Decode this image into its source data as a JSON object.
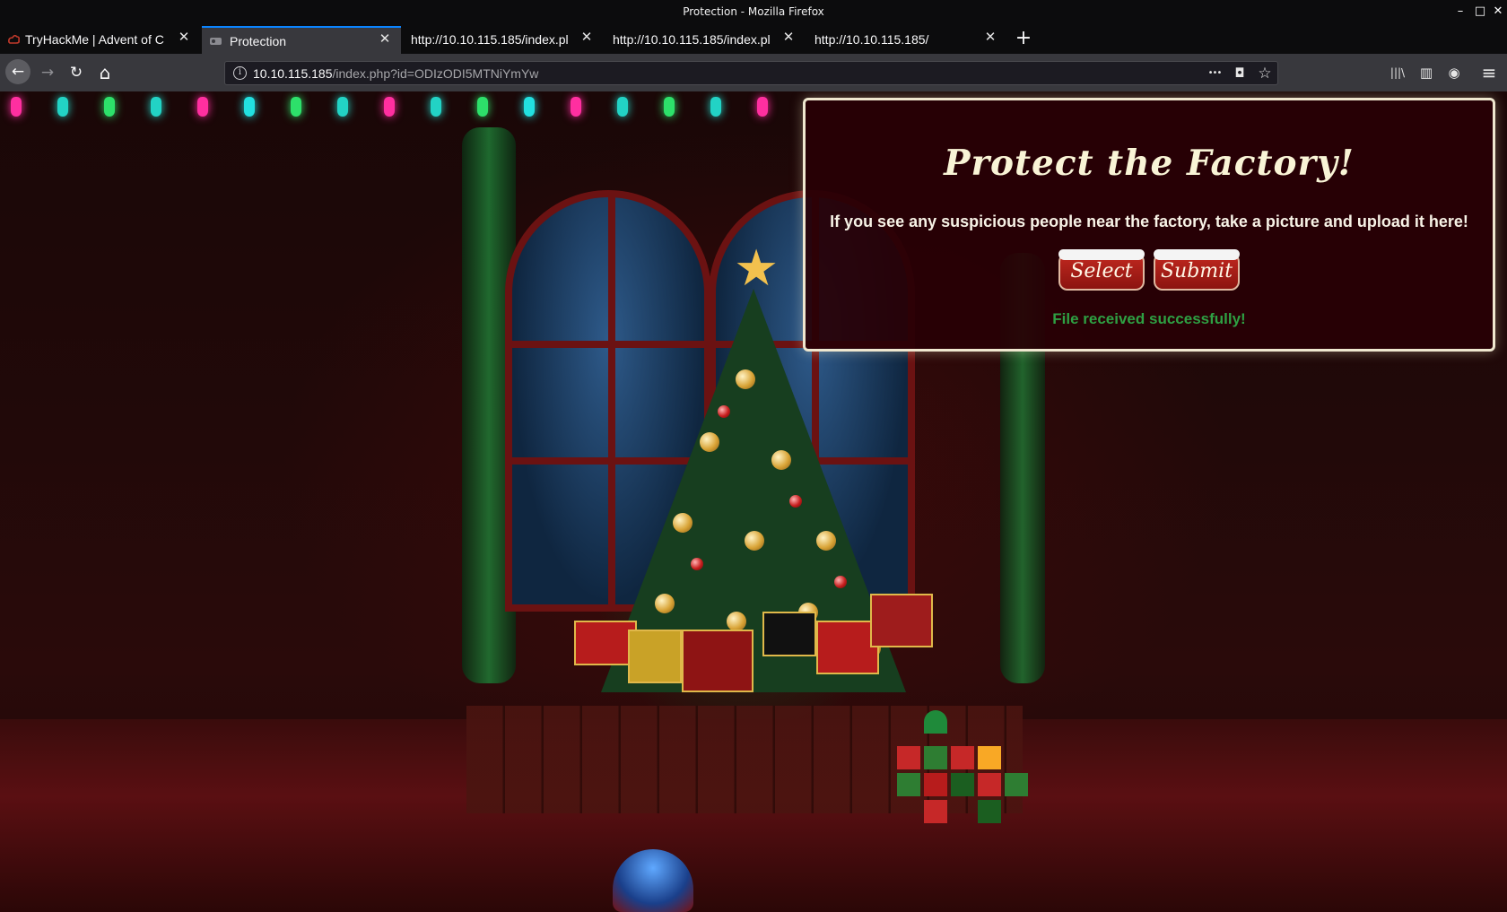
{
  "window": {
    "title": "Protection - Mozilla Firefox",
    "minimize": "–",
    "maximize": "□",
    "close": "✕"
  },
  "tabs": [
    {
      "label": "TryHackMe | Advent of C",
      "active": false
    },
    {
      "label": "Protection",
      "active": true
    },
    {
      "label": "http://10.10.115.185/index.pl",
      "active": false
    },
    {
      "label": "http://10.10.115.185/index.pl",
      "active": false
    },
    {
      "label": "http://10.10.115.185/",
      "active": false
    }
  ],
  "tab_close_glyph": "✕",
  "new_tab_glyph": "+",
  "nav": {
    "back_icon": "←",
    "forward_icon": "→",
    "reload_icon": "↻",
    "home_icon": "⌂",
    "url_host": "10.10.115.185",
    "url_rest": "/index.php?id=ODIzODI5MTNiYmYw",
    "page_actions_icon": "•••",
    "pocket_icon": "◘",
    "bookmark_icon": "☆",
    "library_icon": "|||\\",
    "sidebar_icon": "▥",
    "account_icon": "◉",
    "menu_icon": "≡"
  },
  "page": {
    "title": "Protect the Factory!",
    "description": "If you see any suspicious people near the factory, take a picture and upload it here!",
    "select_label": "Select",
    "submit_label": "Submit",
    "status": "File received successfully!"
  },
  "colors": {
    "tab_accent": "#0a84ff",
    "status_green": "#2ea043",
    "panel_border": "#efe7cf",
    "button_red": "#c0281f"
  }
}
